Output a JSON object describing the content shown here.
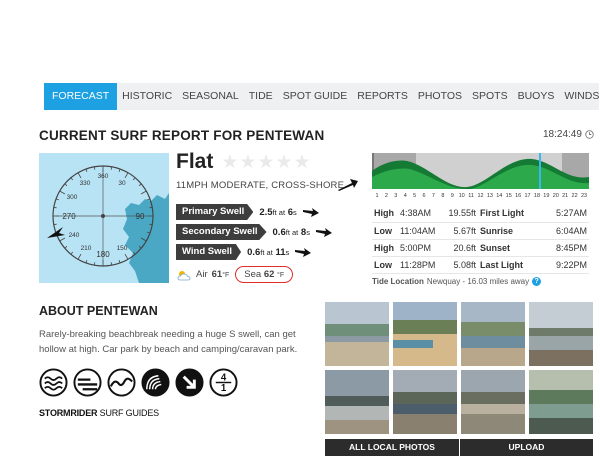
{
  "nav": {
    "tabs": [
      {
        "label": "FORECAST",
        "active": true
      },
      {
        "label": "HISTORIC",
        "active": false
      },
      {
        "label": "SEASONAL",
        "active": false
      },
      {
        "label": "TIDE",
        "active": false
      },
      {
        "label": "SPOT GUIDE",
        "active": false
      },
      {
        "label": "REPORTS",
        "active": false
      },
      {
        "label": "PHOTOS",
        "active": false
      },
      {
        "label": "SPOTS",
        "active": false
      },
      {
        "label": "BUOYS",
        "active": false
      },
      {
        "label": "WINDS",
        "active": false
      }
    ]
  },
  "report": {
    "title": "CURRENT SURF REPORT FOR PENTEWAN",
    "time": "18:24:49",
    "rating": "Flat",
    "stars_filled": 0,
    "stars_total": 5,
    "wind_desc": "11MPH MODERATE, CROSS-SHORE"
  },
  "compass": {
    "labels": [
      "360",
      "330",
      "30",
      "300",
      "270",
      "90",
      "240",
      "210",
      "150",
      "180"
    ]
  },
  "swells": [
    {
      "label": "Primary Swell",
      "height": "2.5",
      "height_unit": "ft at",
      "period": "6",
      "period_unit": "s"
    },
    {
      "label": "Secondary Swell",
      "height": "0.6",
      "height_unit": "ft at",
      "period": "8",
      "period_unit": "s"
    },
    {
      "label": "Wind Swell",
      "height": "0.6",
      "height_unit": "ft at",
      "period": "11",
      "period_unit": "s"
    }
  ],
  "temps": {
    "air_label": "Air",
    "air_value": "61",
    "sea_label": "Sea",
    "sea_value": "62",
    "unit": "°F"
  },
  "tide": {
    "hours": [
      "1",
      "2",
      "3",
      "4",
      "5",
      "6",
      "7",
      "8",
      "9",
      "10",
      "11",
      "12",
      "13",
      "14",
      "15",
      "16",
      "17",
      "18",
      "19",
      "20",
      "21",
      "22",
      "23"
    ],
    "rows": [
      {
        "type": "High",
        "time": "4:38AM",
        "height": "19.55ft",
        "label": "First Light",
        "label_time": "5:27AM"
      },
      {
        "type": "Low",
        "time": "11:04AM",
        "height": "5.67ft",
        "label": "Sunrise",
        "label_time": "6:04AM"
      },
      {
        "type": "High",
        "time": "5:00PM",
        "height": "20.6ft",
        "label": "Sunset",
        "label_time": "8:45PM"
      },
      {
        "type": "Low",
        "time": "11:28PM",
        "height": "5.08ft",
        "label": "Last Light",
        "label_time": "9:22PM"
      }
    ],
    "location_label": "Tide Location",
    "location_value": "Newquay - 16.03 miles away"
  },
  "about": {
    "title": "ABOUT PENTEWAN",
    "text": "Rarely-breaking beachbreak needing a huge S swell, can get hollow at high. Car park by beach and camping/caravan park.",
    "icon_number_top": "4",
    "icon_number_bottom": "1",
    "brand_bold": "STORMRIDER",
    "brand_normal": " SURF GUIDES"
  },
  "photos": {
    "all_label": "ALL LOCAL PHOTOS",
    "upload_label": "UPLOAD"
  },
  "colors": {
    "accent": "#1da1e2",
    "tide_green": "#2ca94b",
    "tide_dark": "#157a33",
    "compass_bg": "#b8e3f4",
    "land_teal": "#4aa8c5",
    "sea_highlight": "#e0302a"
  }
}
